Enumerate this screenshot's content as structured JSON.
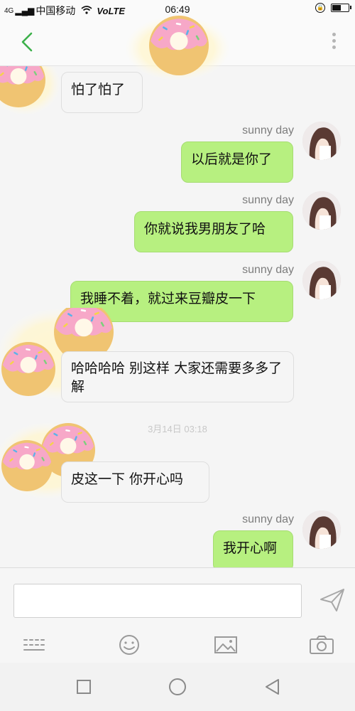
{
  "status_bar": {
    "signal": "4G",
    "carrier": "中国移动",
    "network": "VoLTE",
    "time": "06:49",
    "battery_level": 0.55
  },
  "header": {
    "back_icon": "chevron-left-icon",
    "more_icon": "more-vertical-icon"
  },
  "messages": [
    {
      "side": "in",
      "text": "怕了怕了"
    },
    {
      "side": "out",
      "nick": "sunny day",
      "text": "以后就是你了"
    },
    {
      "side": "out",
      "nick": "sunny day",
      "text": "你就说我男朋友了哈"
    },
    {
      "side": "out",
      "nick": "sunny day",
      "text": "我睡不着，就过来豆瓣皮一下"
    },
    {
      "side": "in",
      "text": "哈哈哈哈 别这样 大家还需要多多了解"
    },
    {
      "side": "time",
      "text": "3月14日 03:18"
    },
    {
      "side": "in",
      "text": "皮这一下 你开心吗"
    },
    {
      "side": "out",
      "nick": "sunny day",
      "text": "我开心啊"
    }
  ],
  "composer": {
    "input_value": "",
    "icons": [
      "send-icon",
      "keyboard-icon",
      "emoji-icon",
      "image-icon",
      "camera-icon"
    ]
  },
  "navbar": {
    "icons": [
      "recent-apps-icon",
      "home-icon",
      "back-icon"
    ]
  },
  "colors": {
    "outgoing_bubble": "#b7f080",
    "incoming_bubble": "#f5f5f5",
    "accent_green": "#3cb04a",
    "background": "#f5f5f5"
  }
}
